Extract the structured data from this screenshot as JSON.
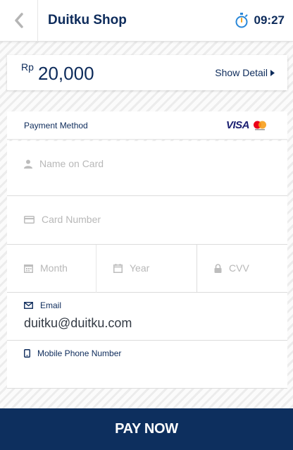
{
  "header": {
    "back_icon": "chevron-left-icon",
    "title": "Duitku Shop",
    "timer_icon": "stopwatch-icon",
    "timer": "09:27"
  },
  "amount": {
    "currency": "Rp",
    "value": "20,000",
    "show_detail": "Show Detail"
  },
  "payment_method": {
    "label": "Payment Method",
    "logos": [
      "VISA",
      "mastercard"
    ]
  },
  "form": {
    "name_placeholder": "Name on Card",
    "card_placeholder": "Card Number",
    "month_placeholder": "Month",
    "year_placeholder": "Year",
    "cvv_placeholder": "CVV",
    "email_label": "Email",
    "email_value": "duitku@duitku.com",
    "phone_label": "Mobile Phone Number",
    "phone_value": ""
  },
  "pay_button": {
    "label": "PAY NOW"
  },
  "colors": {
    "primary": "#0d2f5e",
    "text": "#0d2b5b",
    "placeholder": "#b8b8b8",
    "timer_icon": "#2b88d8"
  }
}
